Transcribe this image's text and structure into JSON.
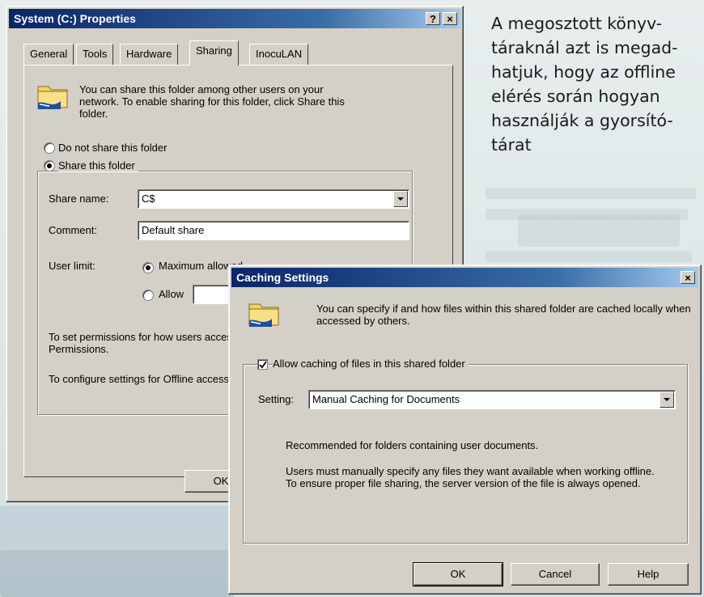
{
  "properties_window": {
    "title": "System (C:) Properties",
    "help_button": "?",
    "close_button": "×",
    "tabs": [
      {
        "label": "General",
        "active": false
      },
      {
        "label": "Tools",
        "active": false
      },
      {
        "label": "Hardware",
        "active": false
      },
      {
        "label": "Sharing",
        "active": true
      },
      {
        "label": "InocuLAN",
        "active": false
      }
    ],
    "intro_text": "You can share this folder among other users on your network.  To enable sharing for this folder, click Share this folder.",
    "radio_do_not_share": "Do not share this folder",
    "radio_share": "Share this folder",
    "share_name_label": "Share name:",
    "share_name_value": "C$",
    "comment_label": "Comment:",
    "comment_value": "Default share",
    "user_limit_label": "User limit:",
    "max_allowed_label": "Maximum allowed",
    "allow_label": "Allow",
    "permissions_text": "To set permissions for how users access this folder over the network, click Permissions.",
    "caching_text": "To configure settings for Offline access to this shared folder, click Caching.",
    "ok_button": "OK"
  },
  "caching_window": {
    "title": "Caching Settings",
    "close_button": "×",
    "intro_text": "You can specify if and how files within this shared folder are cached locally when accessed by others.",
    "allow_caching_label": "Allow caching of files in this shared folder",
    "allow_caching_checked": true,
    "setting_label": "Setting:",
    "setting_value": "Manual Caching for Documents",
    "recommended_text": "Recommended for folders containing user documents.",
    "description_text": "Users must manually specify any files they want available when working offline.  To ensure proper file sharing, the server version of the file is always opened.",
    "ok_button": "OK",
    "cancel_button": "Cancel",
    "help_button": "Help"
  },
  "caption": {
    "lines": [
      "A megosztott könyv-",
      "táraknál azt is megad-",
      "hatjuk, hogy az offline",
      "elérés során hogyan",
      "használják a gyorsító-",
      "tárat"
    ]
  }
}
